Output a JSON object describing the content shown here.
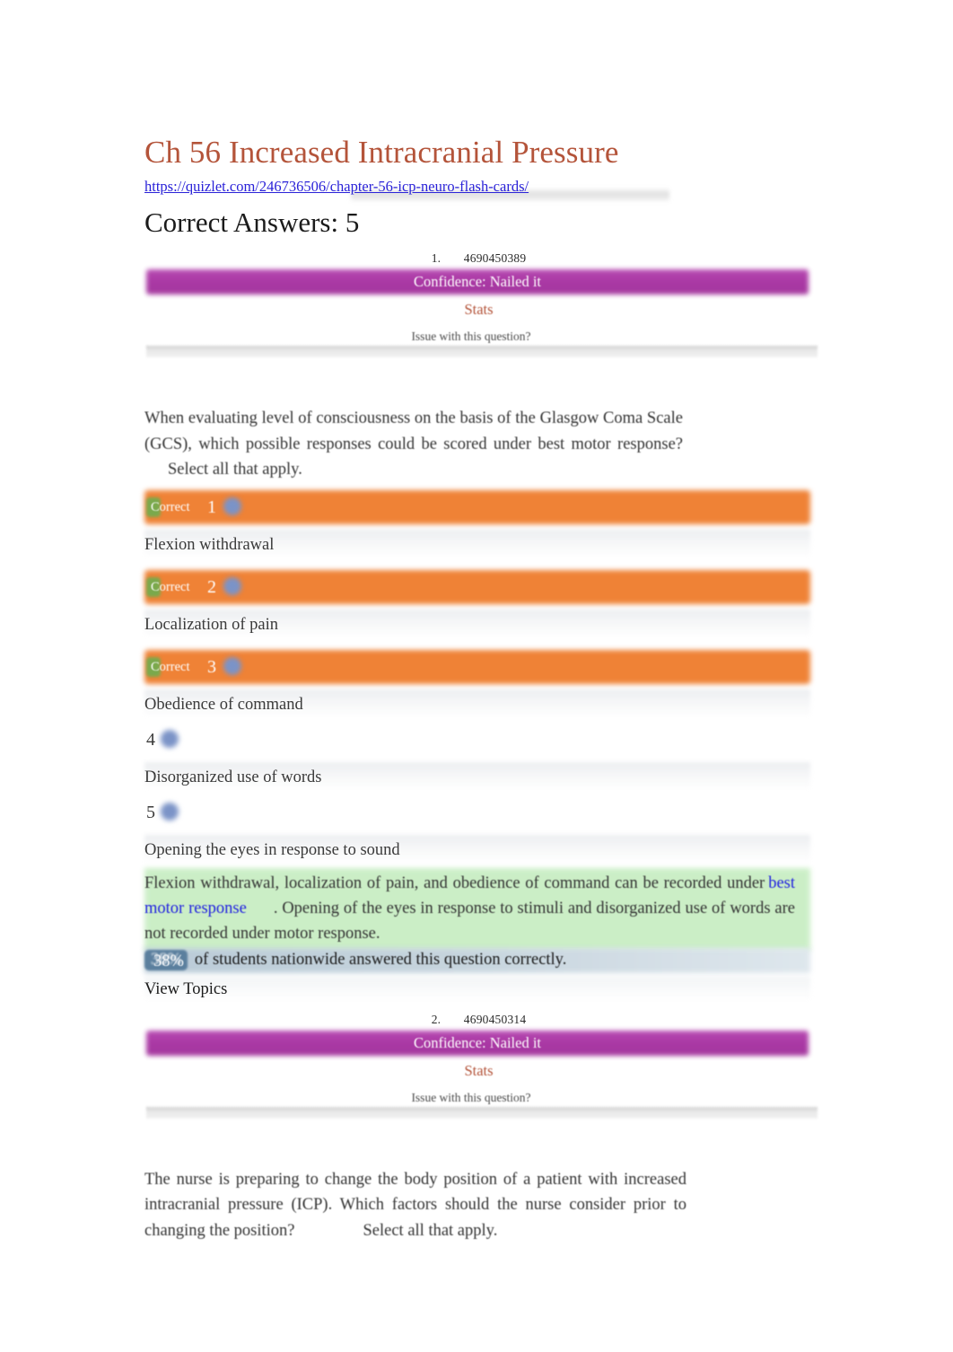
{
  "document": {
    "title": "Ch 56 Increased Intracranial Pressure",
    "url": "https://quizlet.com/246736506/chapter-56-icp-neuro-flash-cards/",
    "section_heading": "Correct Answers: 5"
  },
  "colors": {
    "title": "#b4543a",
    "link": "#2a22d8",
    "confidence_bar": "#a32a9e",
    "stats_link": "#b4543a",
    "selected_choice": "#ef8236",
    "correct_badge": "#7aa94c",
    "rationale_band": "#c9eec4",
    "stat_band": "#b7c9d6",
    "percent_chip": "#5b7f9e",
    "radio": "#7b93c7"
  },
  "labels": {
    "confidence": "Confidence: Nailed it",
    "stats": "Stats",
    "issue": "Issue with this question?",
    "correct_badge": "Correct",
    "view_topics": "View Topics",
    "select_all": "Select all that apply."
  },
  "questions": [
    {
      "number": "1.",
      "id": "4690450389",
      "confidence": "Confidence: Nailed it",
      "stats_label": "Stats",
      "issue_label": "Issue with this question?",
      "prompt": "When evaluating level of consciousness on the basis of the Glasgow Coma Scale (GCS), which possible responses could be scored under best motor response?",
      "prompt_suffix": "Select all that apply.",
      "choices": [
        {
          "num": "1",
          "text": "Flexion withdrawal",
          "selected": true,
          "badge": "Correct"
        },
        {
          "num": "2",
          "text": "Localization of pain",
          "selected": true,
          "badge": "Correct"
        },
        {
          "num": "3",
          "text": "Obedience of command",
          "selected": true,
          "badge": "Correct"
        },
        {
          "num": "4",
          "text": "Disorganized use of words",
          "selected": false,
          "badge": ""
        },
        {
          "num": "5",
          "text": "Opening the eyes in response to sound",
          "selected": false,
          "badge": ""
        }
      ],
      "rationale_part1": "Flexion withdrawal, localization of pain, and obedience of command can be recorded under",
      "rationale_link": "best motor response",
      "rationale_part2": ". Opening of the eyes in response to stimuli and disorganized use of words are not recorded under motor response.",
      "stat_percent": "38%",
      "stat_text": "of students nationwide answered this question correctly.",
      "view_topics": "View Topics"
    },
    {
      "number": "2.",
      "id": "4690450314",
      "confidence": "Confidence: Nailed it",
      "stats_label": "Stats",
      "issue_label": "Issue with this question?",
      "prompt": "The nurse is preparing to change the body position of a patient with increased intracranial pressure (ICP). Which factors should the nurse consider prior to changing the position?",
      "prompt_suffix": "Select all that apply."
    }
  ]
}
